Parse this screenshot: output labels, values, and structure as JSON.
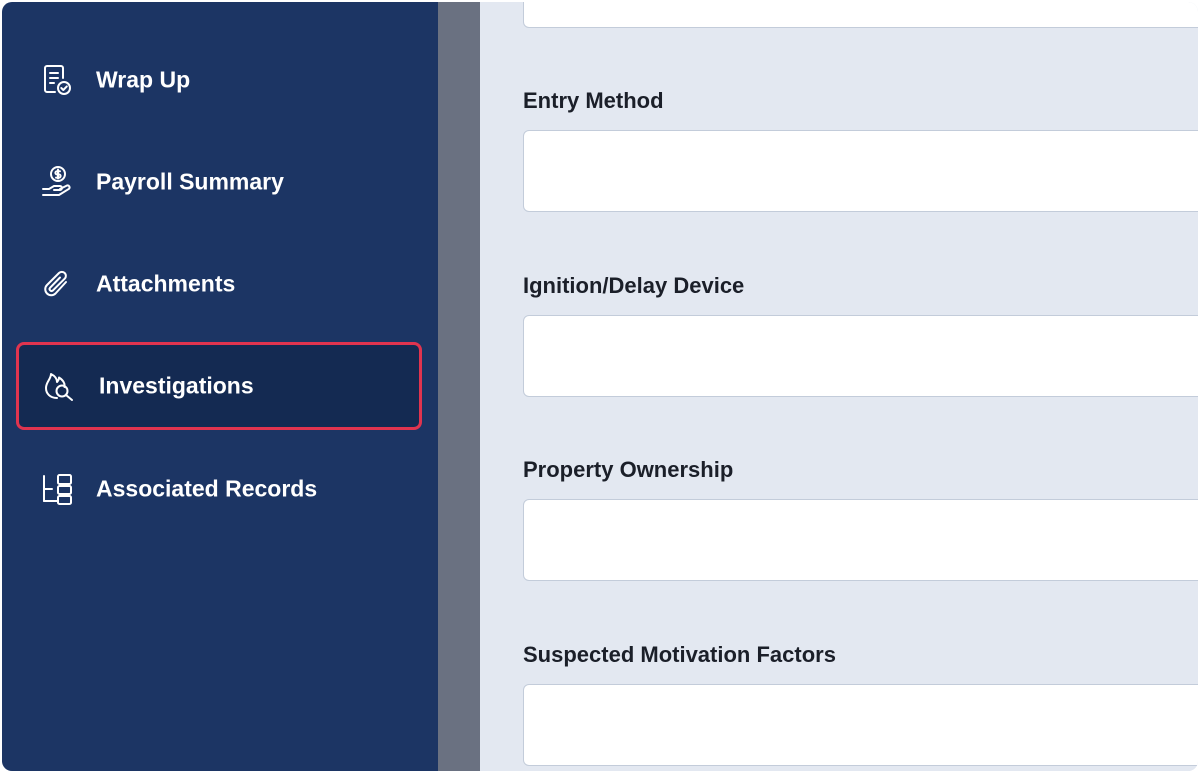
{
  "sidebar": {
    "items": [
      {
        "label": "Wrap Up",
        "icon": "document-check-icon"
      },
      {
        "label": "Payroll Summary",
        "icon": "hand-dollar-icon"
      },
      {
        "label": "Attachments",
        "icon": "paperclip-icon"
      },
      {
        "label": "Investigations",
        "icon": "fire-search-icon",
        "active": true
      },
      {
        "label": "Associated Records",
        "icon": "hierarchy-icon"
      }
    ]
  },
  "form": {
    "fields": [
      {
        "label": "Entry Method",
        "value": ""
      },
      {
        "label": "Ignition/Delay Device",
        "value": ""
      },
      {
        "label": "Property Ownership",
        "value": ""
      },
      {
        "label": "Suspected Motivation Factors",
        "value": ""
      }
    ]
  },
  "colors": {
    "sidebar_bg": "#1c3564",
    "active_item_bg": "#142a52",
    "active_border": "#e0344f",
    "content_bg": "#e3e8f1",
    "divider": "#6a7181"
  }
}
